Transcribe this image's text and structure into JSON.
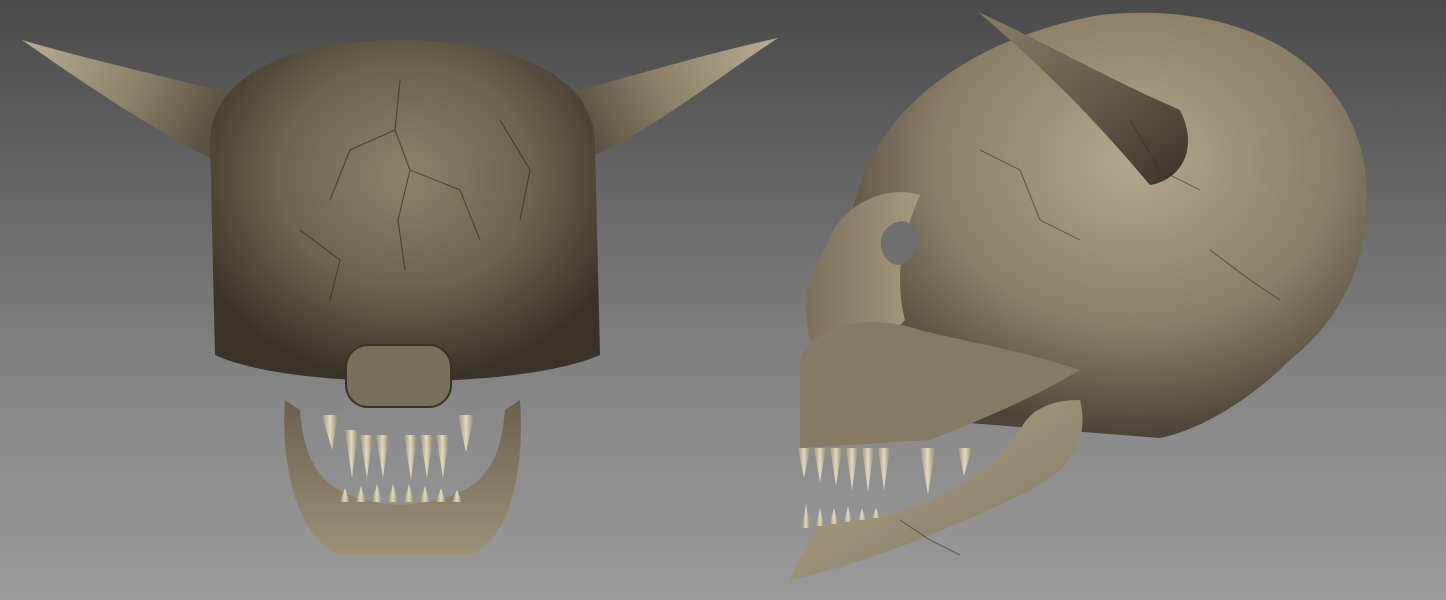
{
  "scene": {
    "background_top": "#4a4a4a",
    "background_bottom": "#9a9a9a",
    "bone_light": "#c8bba0",
    "bone_mid": "#8a7d66",
    "bone_dark": "#3f372b",
    "tooth_color": "#d8cdb4",
    "views": [
      {
        "name": "front-view",
        "subject": "horned-skull"
      },
      {
        "name": "side-view",
        "subject": "horned-skull"
      }
    ]
  }
}
